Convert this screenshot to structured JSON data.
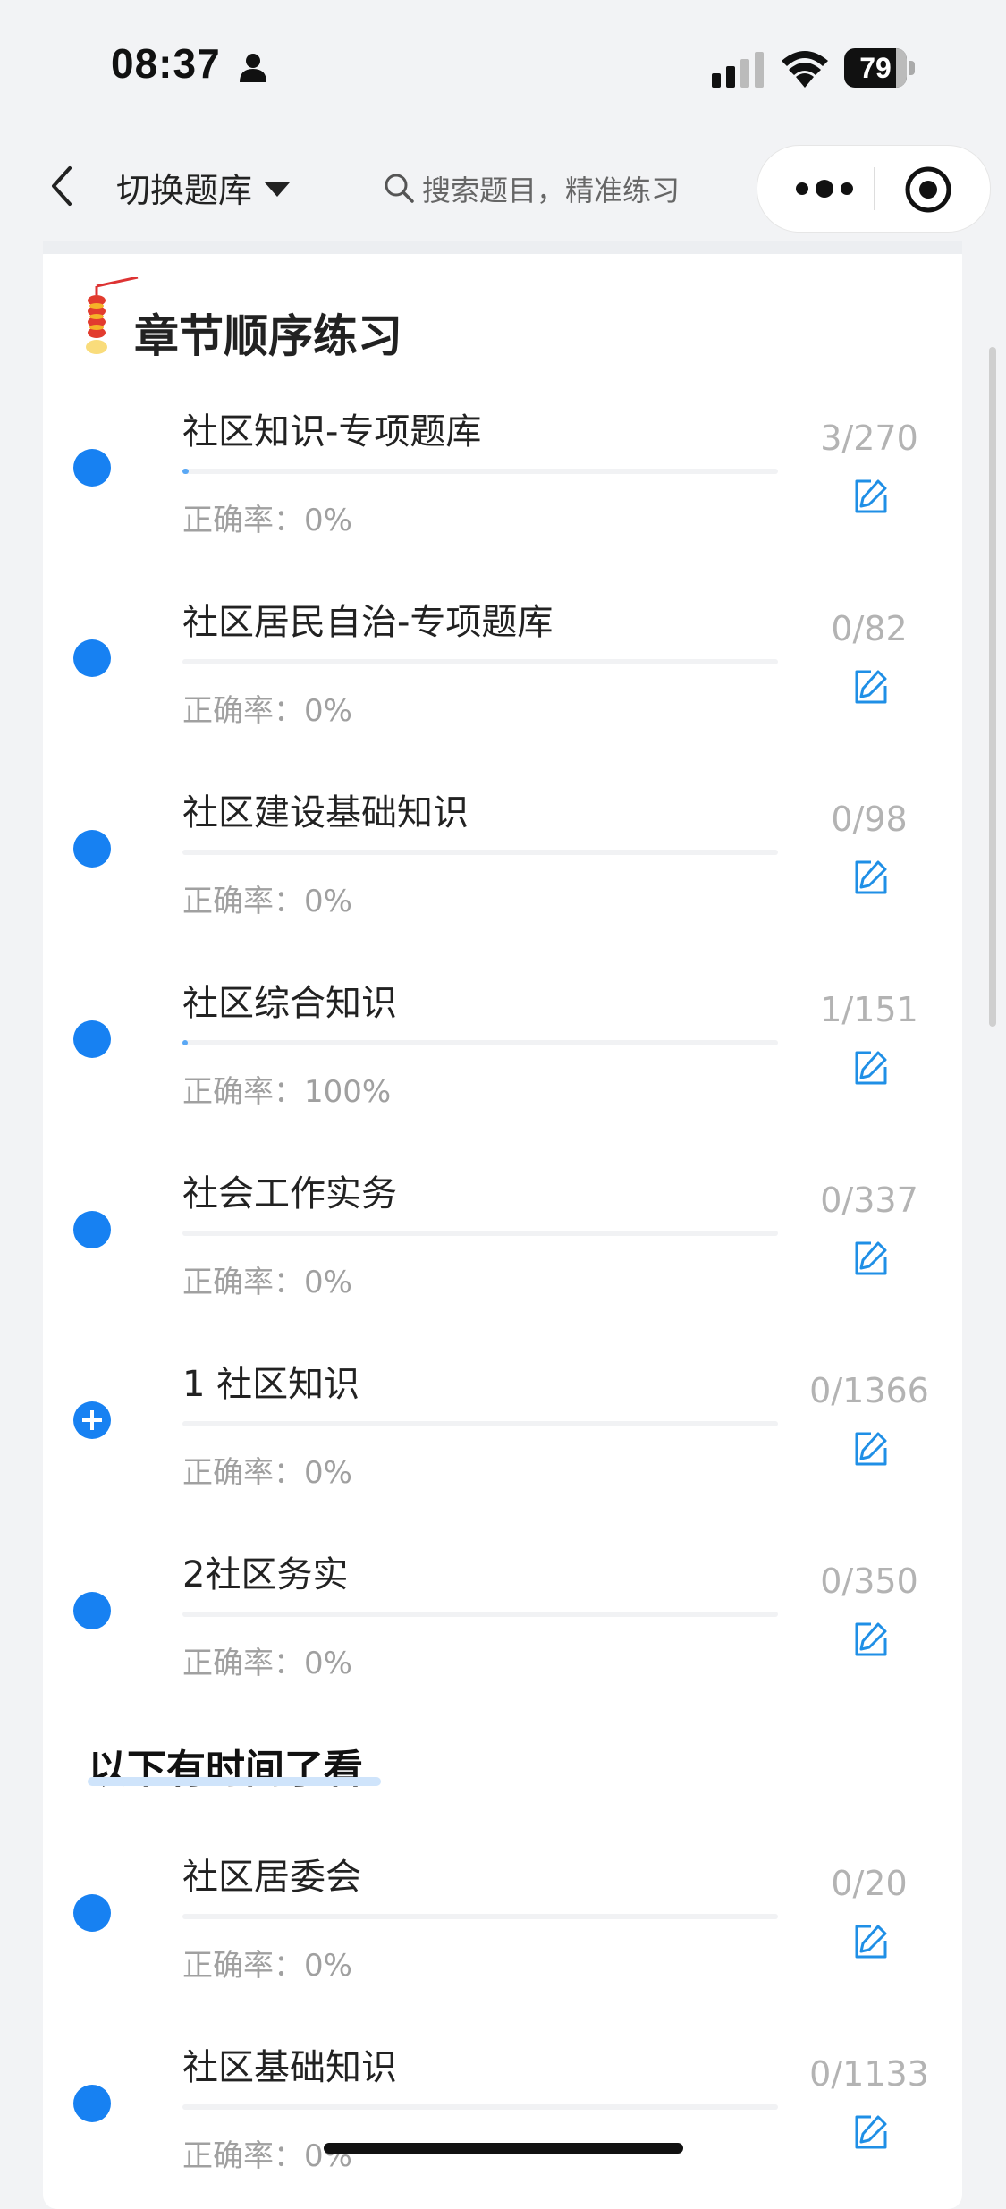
{
  "status_bar": {
    "time": "08:37",
    "battery": "79"
  },
  "nav": {
    "switch_label": "切换题库",
    "search_placeholder": "搜索题目，精准练习"
  },
  "section": {
    "title": "章节顺序练习"
  },
  "items": [
    {
      "name": "社区知识-专项题库",
      "accuracy": "正确率：0%",
      "count": "3/270",
      "progress": 0.011,
      "expandable": false
    },
    {
      "name": "社区居民自治-专项题库",
      "accuracy": "正确率：0%",
      "count": "0/82",
      "progress": 0,
      "expandable": false
    },
    {
      "name": "社区建设基础知识",
      "accuracy": "正确率：0%",
      "count": "0/98",
      "progress": 0,
      "expandable": false
    },
    {
      "name": "社区综合知识",
      "accuracy": "正确率：100%",
      "count": "1/151",
      "progress": 0.007,
      "expandable": false
    },
    {
      "name": "社会工作实务",
      "accuracy": "正确率：0%",
      "count": "0/337",
      "progress": 0,
      "expandable": false
    },
    {
      "name": "1 社区知识",
      "accuracy": "正确率：0%",
      "count": "0/1366",
      "progress": 0,
      "expandable": true
    },
    {
      "name": "2社区务实",
      "accuracy": "正确率：0%",
      "count": "0/350",
      "progress": 0,
      "expandable": false
    }
  ],
  "later_section": {
    "title": "以下有时间了看"
  },
  "later_items": [
    {
      "name": "社区居委会",
      "accuracy": "正确率：0%",
      "count": "0/20",
      "progress": 0,
      "expandable": false
    },
    {
      "name": "社区基础知识",
      "accuracy": "正确率：0%",
      "count": "0/1133",
      "progress": 0,
      "expandable": false
    }
  ],
  "colors": {
    "accent": "#1781f2",
    "progress_fill": "#5aa8f5",
    "edit_icon": "#1f8fe6"
  }
}
